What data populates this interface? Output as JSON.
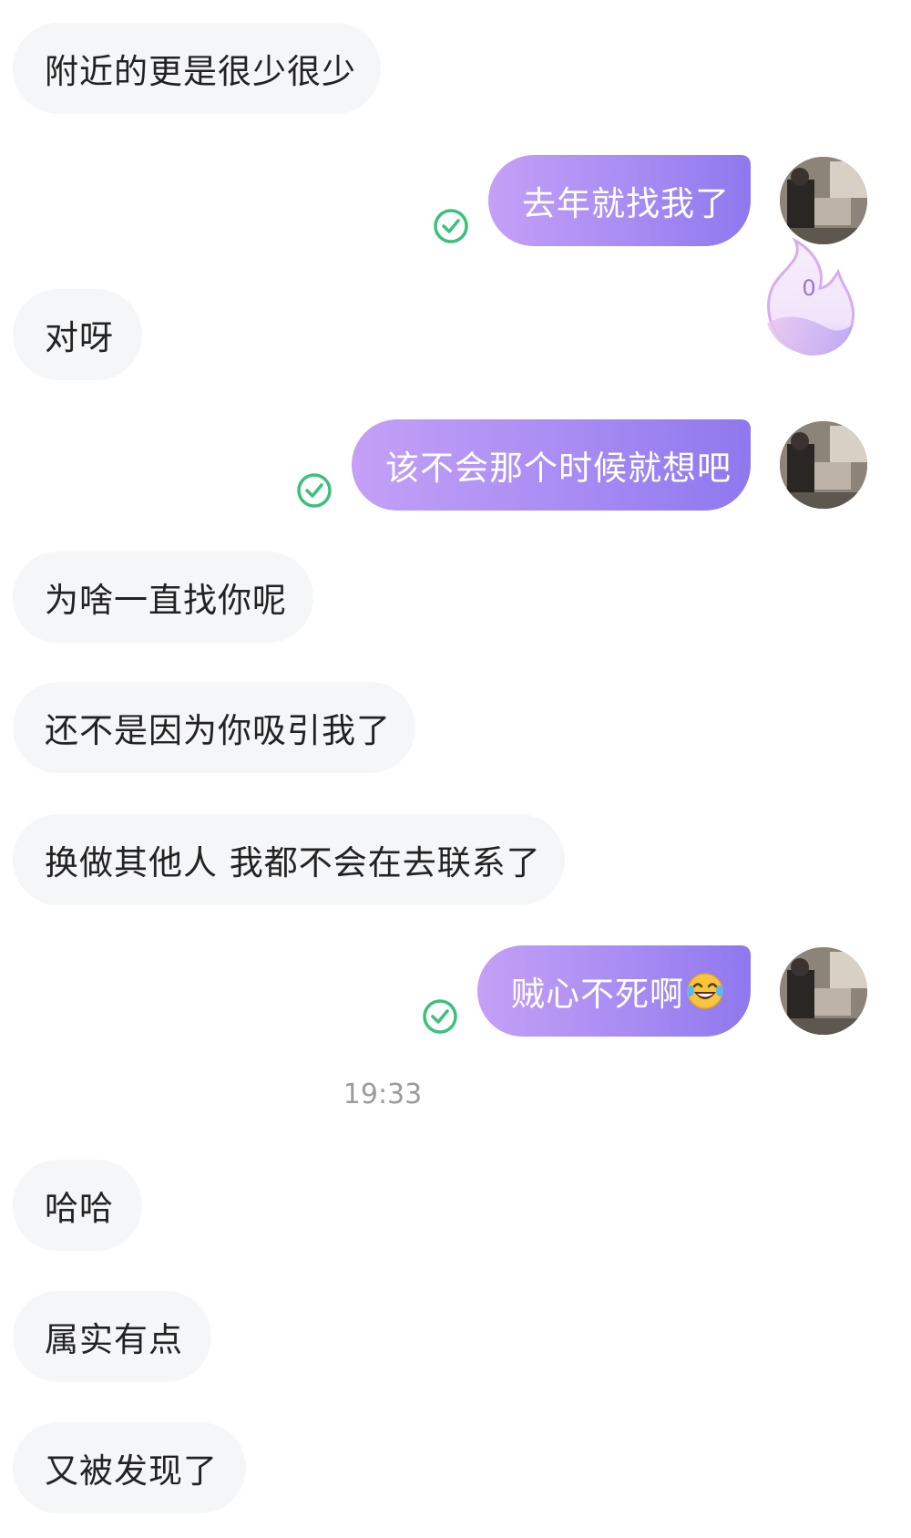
{
  "messages": [
    {
      "side": "in",
      "text": "附近的更是很少很少"
    },
    {
      "side": "out",
      "text": "去年就找我了",
      "status": "delivered-check-icon"
    },
    {
      "side": "in",
      "text": "对呀"
    },
    {
      "side": "out",
      "text": "该不会那个时候就想吧",
      "status": "delivered-check-icon"
    },
    {
      "side": "in",
      "text": "为啥一直找你呢"
    },
    {
      "side": "in",
      "text": "还不是因为你吸引我了"
    },
    {
      "side": "in",
      "text": "换做其他人 我都不会在去联系了"
    },
    {
      "side": "out",
      "text": "贼心不死啊",
      "emoji": "tears-of-joy-emoji",
      "status": "delivered-check-icon"
    },
    {
      "side": "in",
      "text": "哈哈"
    },
    {
      "side": "in",
      "text": "属实有点"
    },
    {
      "side": "in",
      "text": "又被发现了"
    }
  ],
  "timestamp": "19:33",
  "flame_badge": {
    "count": "0",
    "icon": "flame-icon"
  },
  "colors": {
    "incoming_bubble": "#f5f6f8",
    "outgoing_gradient_start": "#c4a0f6",
    "outgoing_gradient_end": "#8f78ee",
    "check": "#3cc07e",
    "timestamp": "#9b9b9b"
  }
}
